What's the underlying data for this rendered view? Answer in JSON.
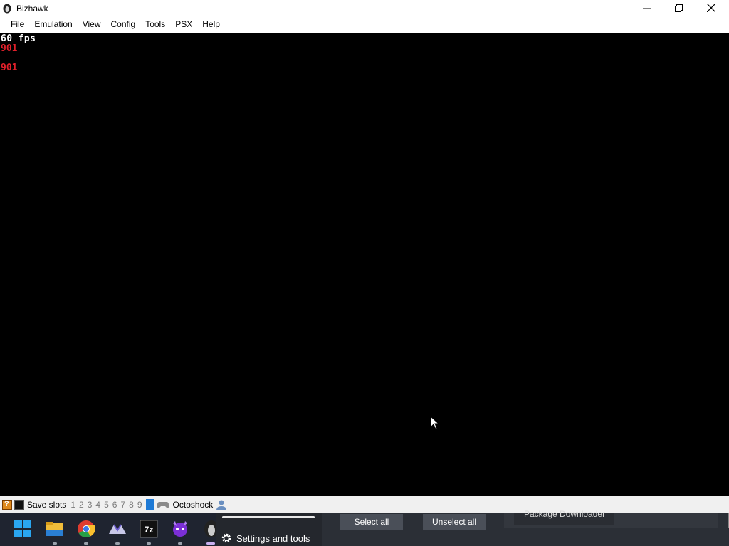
{
  "window": {
    "title": "Bizhawk"
  },
  "menu": [
    "File",
    "Emulation",
    "View",
    "Config",
    "Tools",
    "PSX",
    "Help"
  ],
  "screen": {
    "fps": "60 fps",
    "counter1": "901",
    "counter2": "901",
    "colors": {
      "fps": "#ffffff",
      "counter": "#e0202a",
      "background": "#000000"
    }
  },
  "statusbar": {
    "save_label": "Save slots",
    "slots": [
      "1",
      "2",
      "3",
      "4",
      "5",
      "6",
      "7",
      "8",
      "9"
    ],
    "core_label": "Octoshock",
    "icons": [
      "warning-icon",
      "screen-icon",
      "gamepad-icon",
      "user-icon"
    ]
  },
  "taskbar": {
    "icons": [
      "windows-start-icon",
      "file-explorer-icon",
      "chrome-icon",
      "app-icon",
      "7zip-icon",
      "game-app-icon",
      "bizhawk-icon"
    ]
  },
  "popup": {
    "settings_label": "Settings and tools",
    "select_all": "Select all",
    "unselect_all": "Unselect all",
    "package_label": "Package Downloader"
  }
}
